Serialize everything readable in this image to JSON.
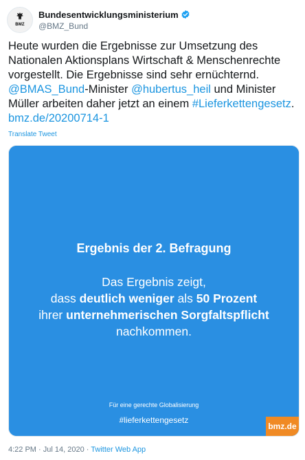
{
  "account": {
    "display_name": "Bundesentwicklungsministerium",
    "handle": "@BMZ_Bund",
    "avatar_abbr": "BMZ",
    "verified": true
  },
  "tweet": {
    "text_1": "Heute wurden die Ergebnisse zur Umsetzung des Nationalen Aktionsplans Wirtschaft & Menschenrechte vorgestellt. Die Ergebnisse sind sehr ernüchternd.",
    "mention_1": "@BMAS_Bund",
    "text_2": "-Minister ",
    "mention_2": "@hubertus_heil",
    "text_3": " und Minister Müller arbeiten daher jetzt an einem ",
    "hashtag": "#Lieferkettengesetz",
    "text_4": ". ",
    "link": "bmz.de/20200714-1",
    "translate_label": "Translate Tweet"
  },
  "media": {
    "title": "Ergebnis der 2. Befragung",
    "line1": "Das Ergebnis zeigt,",
    "line2_pre": "dass ",
    "line2_bold1": "deutlich weniger",
    "line2_mid": " als ",
    "line2_bold2": "50 Prozent",
    "line3_pre": "ihrer ",
    "line3_bold": "unternehmerischen Sorgfaltspflicht",
    "line4": "nachkommen.",
    "footer": "Für eine gerechte Globalisierung",
    "hashtag": "#lieferkettengesetz",
    "logo": "bmz.de",
    "background_color": "#2a8fe2",
    "logo_color": "#f08a24"
  },
  "meta": {
    "time": "4:22 PM",
    "separator": " · ",
    "date": "Jul 14, 2020",
    "source": "Twitter Web App"
  }
}
